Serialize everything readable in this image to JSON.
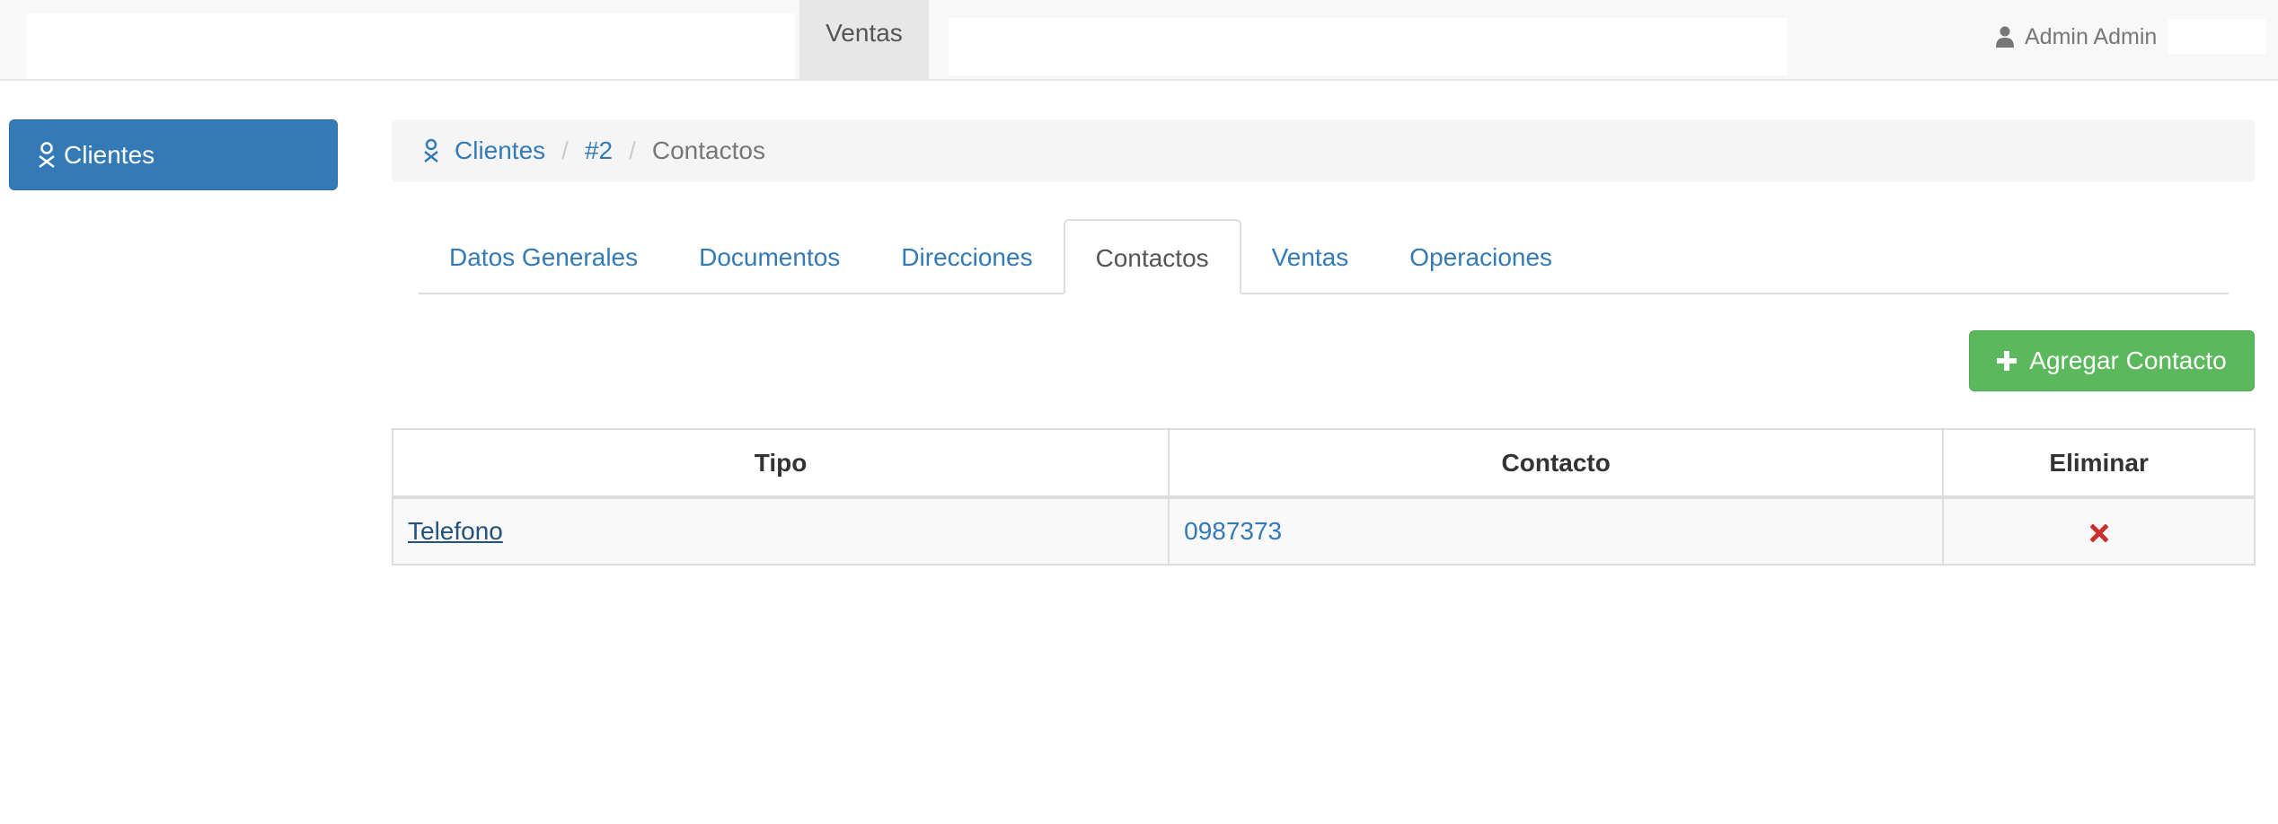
{
  "navbar": {
    "active_menu": "Ventas",
    "user_name": "Admin Admin",
    "user_icon": "user-icon"
  },
  "sidebar": {
    "items": [
      {
        "label": "Clientes",
        "icon": "customer-icon",
        "active": true
      }
    ]
  },
  "breadcrumb": {
    "icon": "customer-icon",
    "items": [
      "Clientes",
      "#2",
      "Contactos"
    ]
  },
  "tabs": [
    {
      "label": "Datos Generales",
      "active": false
    },
    {
      "label": "Documentos",
      "active": false
    },
    {
      "label": "Direcciones",
      "active": false
    },
    {
      "label": "Contactos",
      "active": true
    },
    {
      "label": "Ventas",
      "active": false
    },
    {
      "label": "Operaciones",
      "active": false
    }
  ],
  "actions": {
    "add_contact_label": "Agregar Contacto",
    "add_icon": "plus-icon"
  },
  "table": {
    "headers": [
      "Tipo",
      "Contacto",
      "Eliminar"
    ],
    "rows": [
      {
        "tipo": "Telefono",
        "contacto": "0987373",
        "delete_icon": "remove-icon"
      }
    ]
  },
  "colors": {
    "primary": "#337ab7",
    "success": "#5cb85c",
    "danger": "#c9302c",
    "link": "#337ab7"
  }
}
